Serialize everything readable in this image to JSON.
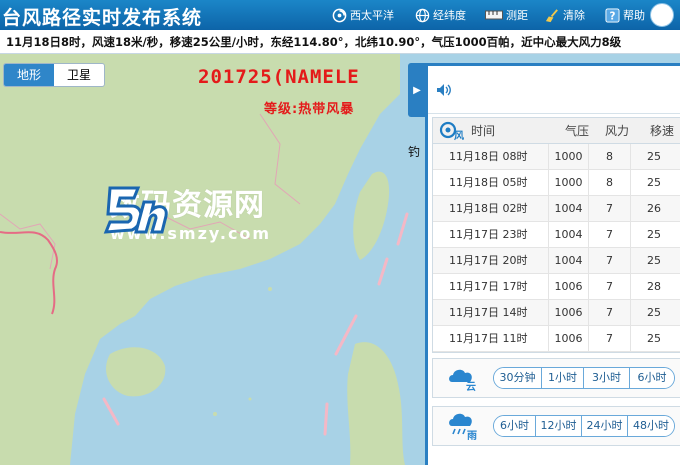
{
  "header": {
    "title": "台风路径实时发布系统",
    "buttons": [
      {
        "label": "西太平洋",
        "icon": "typhoon-icon"
      },
      {
        "label": "经纬度",
        "icon": "globe-icon"
      },
      {
        "label": "测距",
        "icon": "ruler-icon"
      },
      {
        "label": "清除",
        "icon": "broom-icon"
      },
      {
        "label": "帮助",
        "icon": "help-icon"
      }
    ]
  },
  "infobar": {
    "text": "11月18日8时，风速18米/秒，移速25公里/小时，东经114.80°，北纬10.90°，气压1000百帕，近中心最大风力8级"
  },
  "map": {
    "type_toggle": {
      "terrain": "地形",
      "satellite": "卫星",
      "active": "terrain"
    },
    "storm_name": "201725(NAMELE",
    "storm_level": "等级:热带风暴",
    "watermark_cn": "数码资源网",
    "watermark_url": "www.smzy.com",
    "edge_label": "钓"
  },
  "panel": {
    "table": {
      "headers": {
        "icon_label": "风",
        "time": "时间",
        "pressure": "气压",
        "wind": "风力",
        "speed": "移速"
      },
      "rows": [
        {
          "time": "11月18日 08时",
          "pressure": "1000",
          "wind": "8",
          "speed": "25"
        },
        {
          "time": "11月18日 05时",
          "pressure": "1000",
          "wind": "8",
          "speed": "25"
        },
        {
          "time": "11月18日 02时",
          "pressure": "1004",
          "wind": "7",
          "speed": "26"
        },
        {
          "time": "11月17日 23时",
          "pressure": "1004",
          "wind": "7",
          "speed": "25"
        },
        {
          "time": "11月17日 20时",
          "pressure": "1004",
          "wind": "7",
          "speed": "25"
        },
        {
          "time": "11月17日 17时",
          "pressure": "1006",
          "wind": "7",
          "speed": "28"
        },
        {
          "time": "11月17日 14时",
          "pressure": "1006",
          "wind": "7",
          "speed": "25"
        },
        {
          "time": "11月17日 11时",
          "pressure": "1006",
          "wind": "7",
          "speed": "25"
        }
      ]
    },
    "cloud": {
      "icon_label": "云",
      "options": [
        "30分钟",
        "1小时",
        "3小时",
        "6小时"
      ]
    },
    "rain": {
      "icon_label": "雨",
      "options": [
        "6小时",
        "12小时",
        "24小时",
        "48小时"
      ]
    }
  },
  "colors": {
    "header": "#1478bd",
    "panel_border": "#2a7fc2",
    "storm_text": "#e41a1a",
    "sea": "#a8d2e6",
    "land": "#c8dcae"
  }
}
